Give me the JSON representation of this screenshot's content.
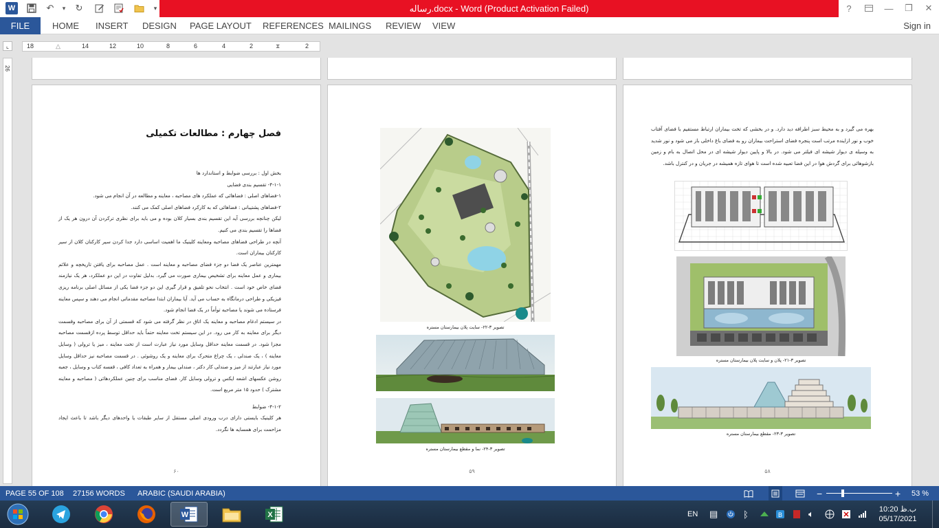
{
  "titlebar": {
    "title": "رساله.docx - Word (Product Activation Failed)",
    "help": "?",
    "min": "—",
    "max": "❐",
    "close": "✕"
  },
  "ribbon": {
    "file": "FILE",
    "tabs": [
      "HOME",
      "INSERT",
      "DESIGN",
      "PAGE LAYOUT",
      "REFERENCES",
      "MAILINGS",
      "REVIEW",
      "VIEW"
    ],
    "signin": "Sign in"
  },
  "ruler": {
    "ticks": [
      "18",
      "14",
      "12",
      "10",
      "8",
      "6",
      "4",
      "2",
      "2"
    ],
    "vertical": "26"
  },
  "page_left": {
    "heading": "فصل چهارم : مطالعات تکمیلی",
    "paragraphs": [
      "بخش اول : بررسی ضوابط و استاندارد ها",
      "۴-۱-۱- تقسیم بندی فضایی",
      "۱-فضاهای اصلی : فضاهائی که عملکرد های مصاحبه ، معاینه و مطالعه در آن انجام می شود.",
      "۲-فضاهای پشتیبانی : فضاهائی که به کارکرد فضاهای اصلی کمک می کنند.",
      "لیکن چنانچه بررسی آید این تقسیم بندی بسیار کلان بوده و می باید برای نظری ترکردن آن درون هر یک از فضاها را تقسیم بندی می کنیم.",
      "آنچه در طراحی فضاهای مصاحبه ومعاینه کلینیک ما اهمیت اساسی دارد جدا کردن سیر کارکنان کلان از سیر کارکنان بیماران است.",
      "مهمترین عناصر یک فضا دو جزء فضای مصاحبه و معاینه است . عمل مصاحبه برای یافتن تاریخچه و علائم بیماری و عمل معاینه برای تشخیص بیماری صورت می گیرد. بدلیل تفاوت در این دو عملکرد، هر یک نیازمند فضای خاص خود است . انتخاب نحو تلفیق و قرار گیری این دو جزء فضا یکی از مسائل اصلی برنامه ریزی فیزیکی و طراحی درمانگاه به حساب می آید. آیا بیماران ابتدا مصاحبه مقدماتی انجام می دهند و سپس معاینه فرستاده می شوند یا مصاحبه توأماً در یک فضا انجام شود.",
      "در سیستم ادغام مصاحبه و معاینه یک اتاق در نظر گرفته می شود که قسمتی از آن برای مصاحبه وقسمت دیگر برای معاینه به کار می رود. در این سیستم تخت معاینه حتماً باید حداقل توسط پرده ازقسمت مصاحبه مجزا شود. در قسمت معاینه حداقل وسایل مورد نیاز عبارت است از تخت معاینه ، میز یا ترولی ( وسایل معاینه ) ، یک صندلی ، یک چراغ متحرک برای معاینه و یک روشوئی . در قسمت مصاحبه نیز حداقل وسایل مورد نیاز عبارتند از میز و صندلی کار دکتر ، صندلی بیمار و همراه به تعداد کافی ، قفسه کتاب و وسایل ، جعبه روشن عکسهای اشعه ایکس و ترولی وسایل کار. فضای مناسب برای چنین عملکردهائی ( مصاحبه و معاینه مشترک ) حدود ۱۵ متر مربع است.",
      "۴-۱-۲- ضوابط",
      "هر کلینیک بایستی دارای درب ورودی اصلی مستقل از سایر طبقات یا واحدهای دیگر باشد تا باعث ایجاد مزاحمت برای همسایه ها نگردد."
    ],
    "page_number": "۶۰"
  },
  "page_middle": {
    "captions": [
      "تصویر ۳-۲۲- سایت پلان بیمارستان مستره",
      "تصویر ۳-۲۴- نما و مقطع بیمارستان مستره"
    ],
    "page_number": "۵۹"
  },
  "page_right": {
    "paragraph": "بهره می گیرد و به محیط سبز اطرافه دید دارد. و در بخشی که تخت بیماران ارتباط مستقیم با فضای آفتاب خوب و نور ازاینده مرتب است پنجره فضای استراحت بیماران رو به فضای باغ داخلی باز می شود و نور شدید به وسیله ی دیوار شیشه ای فیلتر می شود. در بالا و پایین دیوار شیشه ای در محل اتصال به بام و زمین بازشوهائی برای گردش هوا در این فضا تعبیه شده است تا هوای تازه همیشه در جریان و در کنترل باشد.",
    "captions": [
      "تصویر ۳-۲۱- پلان و سایت پلان بیمارستان مستره",
      "تصویر ۳-۲۳- مقطع بیمارستان مستره"
    ],
    "page_number": "۵۸"
  },
  "statusbar": {
    "page": "PAGE 55 OF 108",
    "words": "27156 WORDS",
    "language": "ARABIC (SAUDI ARABIA)",
    "zoom": "53 %",
    "zoom_value": 53,
    "minus": "−",
    "plus": "+"
  },
  "taskbar": {
    "lang": "EN",
    "time": "10:20 ب.ظ",
    "date": "05/17/2021"
  },
  "colors": {
    "accent": "#2b579a",
    "title_alert": "#e81123"
  }
}
